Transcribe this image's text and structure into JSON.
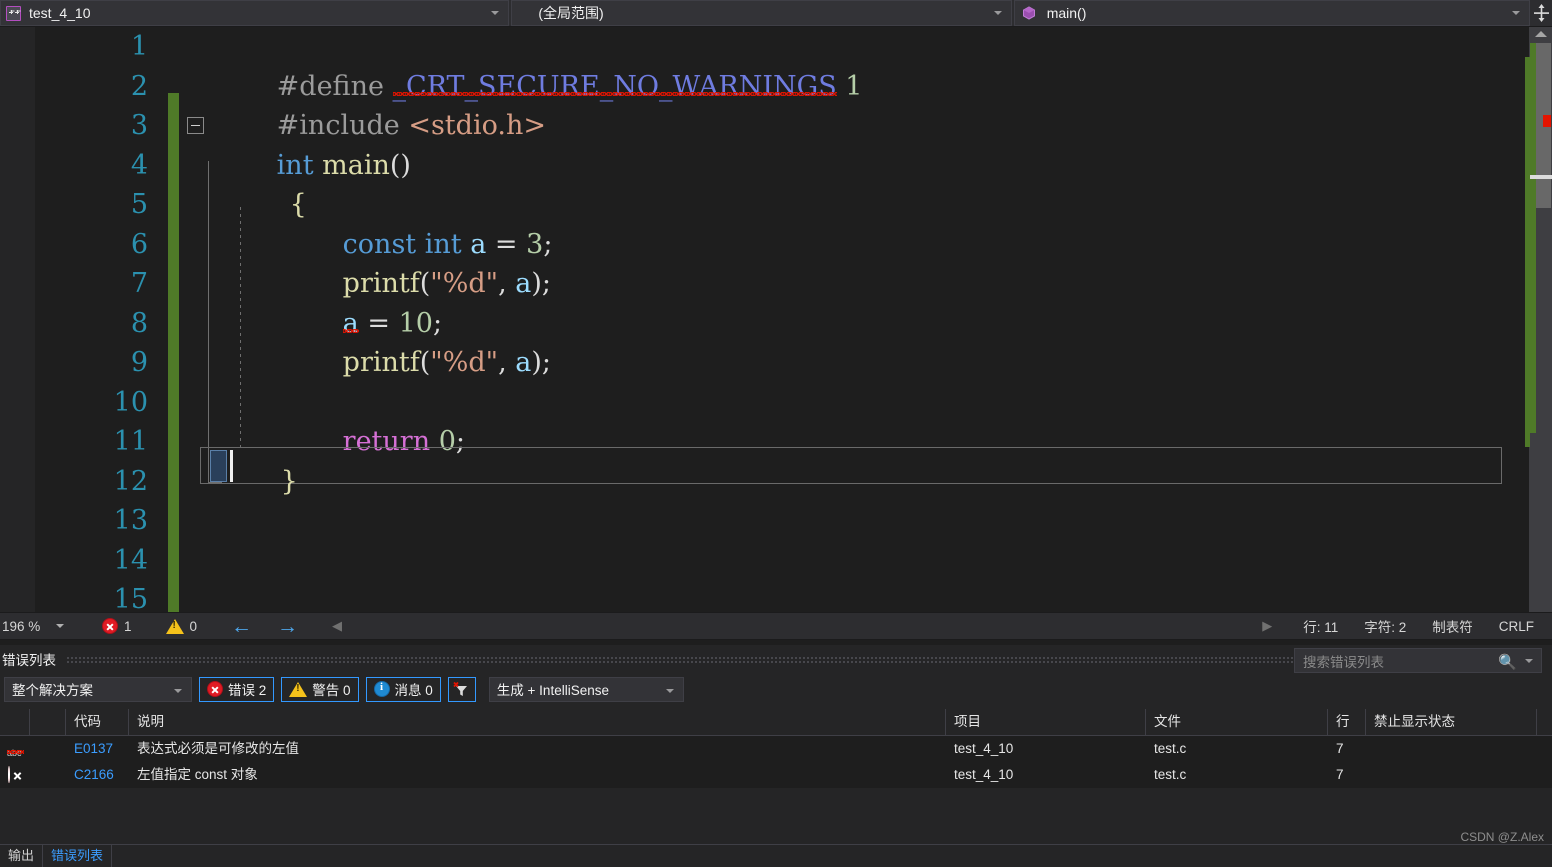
{
  "navbar": {
    "project_label": "test_4_10",
    "project_icon": "cpp-project-icon",
    "scope_label": "(全局范围)",
    "member_label": "main()",
    "member_icon": "method-cube-icon",
    "splitter_icon": "split-window-icon",
    "dropdown_icon": "chevron-down-icon"
  },
  "editor": {
    "lines": [
      {
        "n": "1",
        "text": "#define _CRT_SECURE_NO_WARNINGS 1"
      },
      {
        "n": "2",
        "text": "#include <stdio.h>"
      },
      {
        "n": "3",
        "text": "int main()"
      },
      {
        "n": "4",
        "text": "{"
      },
      {
        "n": "5",
        "text": "    const int a = 3;"
      },
      {
        "n": "6",
        "text": "    printf(\"%d\", a);"
      },
      {
        "n": "7",
        "text": "    a = 10;"
      },
      {
        "n": "8",
        "text": "    printf(\"%d\", a);"
      },
      {
        "n": "9",
        "text": ""
      },
      {
        "n": "10",
        "text": "    return 0;"
      },
      {
        "n": "11",
        "text": "}"
      },
      {
        "n": "12",
        "text": ""
      },
      {
        "n": "13",
        "text": ""
      },
      {
        "n": "14",
        "text": ""
      },
      {
        "n": "15",
        "text": ""
      }
    ],
    "tokens": {
      "l1_define": "#define",
      "l1_macro": "_CRT_SECURE_NO_WARNINGS",
      "l1_value": "1",
      "l2_include": "#include",
      "l2_header": "<stdio.h>",
      "l3_int": "int",
      "l3_main": "main",
      "l3_parens": "()",
      "l4_brace": "{",
      "l5_const": "const",
      "l5_int": "int",
      "l5_var": "a",
      "l5_eq": "=",
      "l5_num": "3",
      "l5_semi": ";",
      "l6_fn": "printf",
      "l6_open": "(",
      "l6_str": "\"%d\"",
      "l6_comma": ",",
      "l6_var": "a",
      "l6_close": ")",
      "l6_semi": ";",
      "l7_var": "a",
      "l7_eq": "=",
      "l7_num": "10",
      "l7_semi": ";",
      "l8_fn": "printf",
      "l8_open": "(",
      "l8_str": "\"%d\"",
      "l8_comma": ",",
      "l8_var": "a",
      "l8_close": ")",
      "l8_semi": ";",
      "l10_return": "return",
      "l10_num": "0",
      "l10_semi": ";",
      "l11_brace": "}"
    },
    "collapse_icon": "collapse-minus-icon",
    "scroll_up_icon": "scroll-up-arrow-icon",
    "colors": {
      "background": "#1e1e1e",
      "line_number": "#2b91af",
      "keyword": "#569cd6",
      "identifier": "#9cdcfe",
      "function": "#dcdcaa",
      "string": "#d69d85",
      "number": "#b5cea8",
      "macro": "#6f7ce0",
      "preprocessor": "#9b9b9b",
      "return_keyword": "#d670d6",
      "change_bar": "#4f7a28",
      "error_marker": "#e51400"
    }
  },
  "statusbar": {
    "zoom": "196 %",
    "error_count": "1",
    "warning_count": "0",
    "back_icon": "arrow-left-icon",
    "forward_icon": "arrow-right-icon",
    "collapse_icon": "triangle-left-icon",
    "expand_icon": "triangle-right-icon",
    "line_label": "行: 11",
    "char_label": "字符: 2",
    "tab_label": "制表符",
    "eol_label": "CRLF"
  },
  "panel": {
    "title": "错误列表",
    "dropdown_icon": "chevron-down-icon",
    "pin_icon": "pin-icon",
    "close_icon": "close-icon",
    "scope": "整个解决方案",
    "errors_toggle": "错误 2",
    "warnings_toggle": "警告 0",
    "messages_toggle": "消息 0",
    "filter_icon": "clear-filter-icon",
    "build_filter": "生成 + IntelliSense",
    "search_placeholder": "搜索错误列表",
    "search_icon": "magnifier-icon",
    "columns": [
      "",
      "",
      "代码",
      "说明",
      "项目",
      "文件",
      "行",
      "禁止显示状态",
      ""
    ],
    "rows": [
      {
        "icon": "intellisense-error-icon",
        "code": "E0137",
        "description": "表达式必须是可修改的左值",
        "project": "test_4_10",
        "file": "test.c",
        "line": "7",
        "suppression": ""
      },
      {
        "icon": "build-error-icon",
        "code": "C2166",
        "description": "左值指定 const 对象",
        "project": "test_4_10",
        "file": "test.c",
        "line": "7",
        "suppression": ""
      }
    ]
  },
  "bottom_tabs": [
    {
      "label": "输出",
      "active": false
    },
    {
      "label": "错误列表",
      "active": true
    }
  ],
  "watermark": "CSDN @Z.Alex"
}
